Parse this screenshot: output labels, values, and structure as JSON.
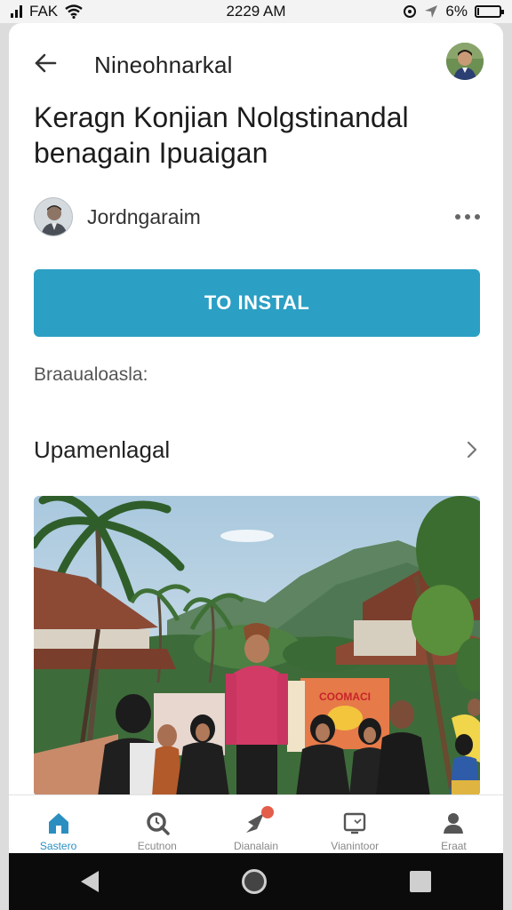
{
  "status_bar": {
    "carrier": "FAK",
    "time": "2229 AM",
    "battery": "6%"
  },
  "header": {
    "title": "Nineohnarkal",
    "back_icon": "arrow-left-icon",
    "avatar_icon": "user-avatar"
  },
  "page": {
    "title": "Keragn Konjian Nolgstinandal benagain Ipuaigan"
  },
  "author": {
    "name": "Jordngaraim",
    "more_icon": "more-horizontal-icon"
  },
  "install_button": {
    "label": "TO INSTAL",
    "color": "#2b9fc4"
  },
  "section": {
    "label": "Braaualoasla:"
  },
  "nav_row": {
    "label": "Upamenlagal",
    "icon": "chevron-right-icon"
  },
  "photo": {
    "banner_text": "COOMACI"
  },
  "tabs": [
    {
      "label": "Sastero",
      "icon": "home-icon",
      "active": true
    },
    {
      "label": "Ecutnon",
      "icon": "search-icon",
      "active": false
    },
    {
      "label": "Dianalain",
      "icon": "rocket-icon",
      "active": false,
      "badge": true
    },
    {
      "label": "Vianintoor",
      "icon": "monitor-icon",
      "active": false
    },
    {
      "label": "Eraat",
      "icon": "profile-icon",
      "active": false
    }
  ],
  "colors": {
    "accent": "#2b9fc4",
    "active_tab": "#2a8fc0",
    "badge": "#e35d4a"
  }
}
